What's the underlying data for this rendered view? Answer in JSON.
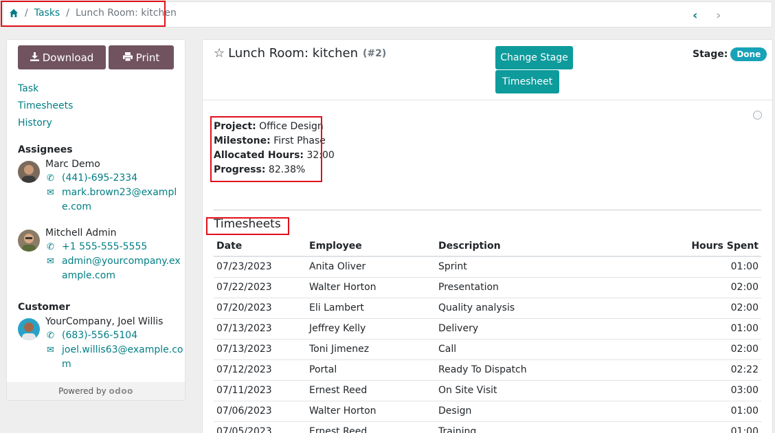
{
  "breadcrumb": {
    "items": [
      "Tasks"
    ],
    "current": "Lunch Room: kitchen"
  },
  "pager": {
    "prev": "‹",
    "next": "›"
  },
  "sidebar": {
    "download_label": "Download",
    "print_label": "Print",
    "links": [
      "Task",
      "Timesheets",
      "History"
    ],
    "assignees_heading": "Assignees",
    "assignees": [
      {
        "name": "Marc Demo",
        "phone": "(441)-695-2334",
        "email": "mark.brown23@example.com"
      },
      {
        "name": "Mitchell Admin",
        "phone": "+1 555-555-5555",
        "email": "admin@yourcompany.example.com"
      }
    ],
    "customer_heading": "Customer",
    "customer": {
      "name": "YourCompany, Joel Willis",
      "phone": "(683)-556-5104",
      "email": "joel.willis63@example.com"
    },
    "powered_by": "Powered by",
    "powered_logo": "odoo"
  },
  "task": {
    "title": "Lunch Room: kitchen",
    "number": "(#2)",
    "change_stage_label": "Change Stage",
    "timesheet_label": "Timesheet",
    "stage_label": "Stage:",
    "stage_value": "Done",
    "fields": [
      {
        "label": "Project:",
        "value": "Office Design"
      },
      {
        "label": "Milestone:",
        "value": "First Phase"
      },
      {
        "label": "Allocated Hours:",
        "value": "32:00"
      },
      {
        "label": "Progress:",
        "value": "82.38%"
      }
    ]
  },
  "timesheets": {
    "title": "Timesheets",
    "columns": [
      "Date",
      "Employee",
      "Description",
      "Hours Spent"
    ],
    "rows": [
      [
        "07/23/2023",
        "Anita Oliver",
        "Sprint",
        "01:00"
      ],
      [
        "07/22/2023",
        "Walter Horton",
        "Presentation",
        "02:00"
      ],
      [
        "07/20/2023",
        "Eli Lambert",
        "Quality analysis",
        "02:00"
      ],
      [
        "07/13/2023",
        "Jeffrey Kelly",
        "Delivery",
        "01:00"
      ],
      [
        "07/13/2023",
        "Toni Jimenez",
        "Call",
        "02:00"
      ],
      [
        "07/12/2023",
        "Portal",
        "Ready To Dispatch",
        "02:22"
      ],
      [
        "07/11/2023",
        "Ernest Reed",
        "On Site Visit",
        "03:00"
      ],
      [
        "07/06/2023",
        "Walter Horton",
        "Design",
        "01:00"
      ],
      [
        "07/05/2023",
        "Ernest Reed",
        "Training",
        "01:00"
      ]
    ]
  },
  "colors": {
    "accent": "#017e84",
    "button_primary": "#71535f",
    "button_teal": "#0e9b9c",
    "badge": "#17a2b8",
    "highlight": "#e0101a"
  }
}
